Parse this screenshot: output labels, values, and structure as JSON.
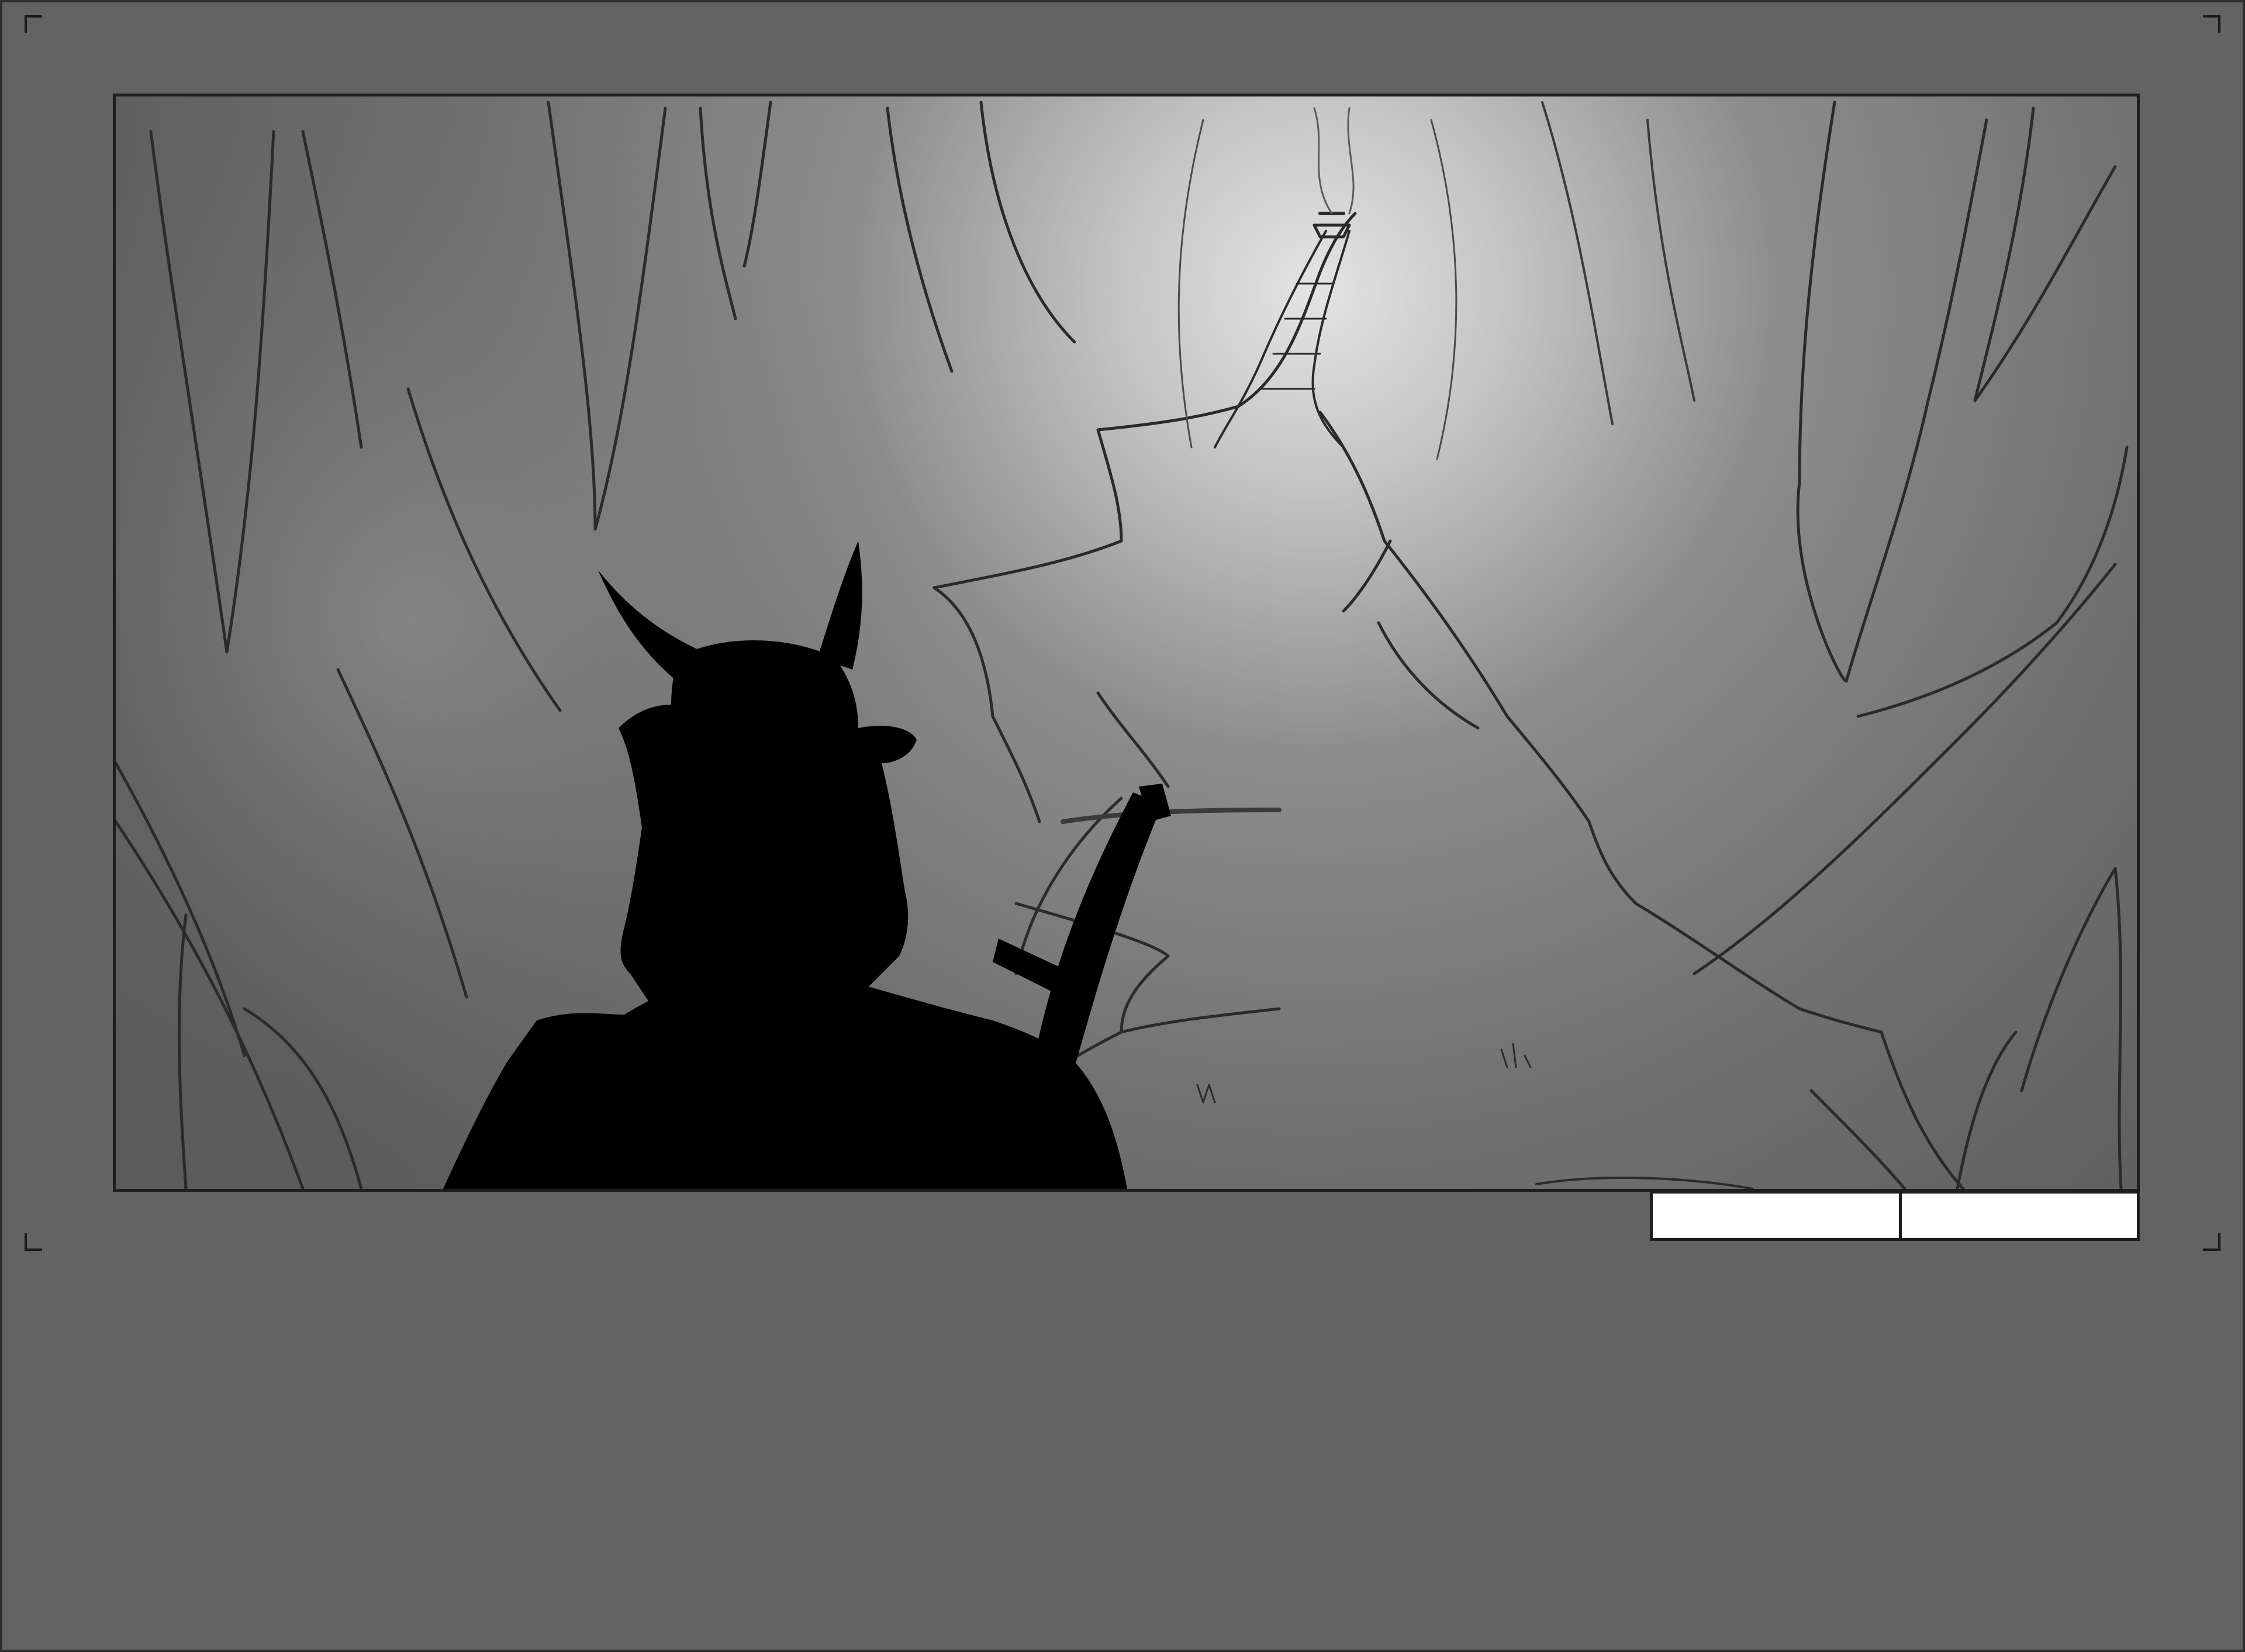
{
  "storyboard": {
    "panel": {
      "scene_icon": "samurai-silhouette-icon",
      "background_icon": "canyon-path-to-shrine-icon"
    },
    "caption_boxes": [
      {
        "text": ""
      },
      {
        "text": ""
      }
    ],
    "colors": {
      "page_background": "#636363",
      "frame_border": "#1e1e1e",
      "silhouette": "#000000",
      "glow": "#e2e2e2",
      "caption_fill": "#ffffff"
    }
  }
}
